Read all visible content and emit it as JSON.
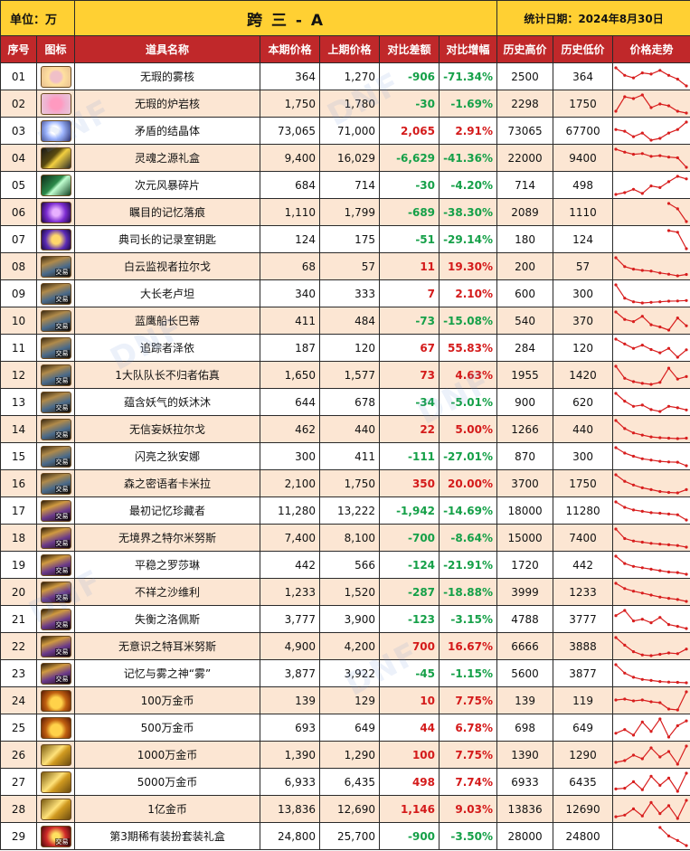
{
  "header": {
    "unit": "单位：万",
    "title": "跨 三 - A",
    "date": "统计日期：2024年8月30日"
  },
  "columns": [
    "序号",
    "图标",
    "道具名称",
    "本期价格",
    "上期价格",
    "对比差额",
    "对比增幅",
    "历史高价",
    "历史低价",
    "价格走势"
  ],
  "rows": [
    {
      "idx": "01",
      "icon": "mist-core-icon",
      "name": "无瑕的雾核",
      "cur": "364",
      "prev": "1,270",
      "diff": "-906",
      "pct": "-71.34%",
      "high": "2500",
      "low": "364",
      "trend": [
        1.8,
        1.2,
        1.0,
        1.4,
        1.3,
        1.6,
        1.2,
        0.9,
        0.36
      ]
    },
    {
      "idx": "02",
      "icon": "lava-core-icon",
      "name": "无瑕的炉岩核",
      "cur": "1,750",
      "prev": "1,780",
      "diff": "-30",
      "pct": "-1.69%",
      "high": "2298",
      "low": "1750",
      "trend": [
        1800,
        2200,
        2150,
        2250,
        1900,
        2000,
        1950,
        1800,
        1750
      ]
    },
    {
      "idx": "03",
      "icon": "crystal-icon",
      "name": "矛盾的结晶体",
      "cur": "73,065",
      "prev": "71,000",
      "diff": "2,065",
      "pct": "2.91%",
      "high": "73065",
      "low": "67700",
      "trend": [
        71000,
        70500,
        69000,
        70000,
        68000,
        68500,
        70000,
        71000,
        73065
      ]
    },
    {
      "idx": "04",
      "icon": "soul-gift-box-icon",
      "name": "灵魂之源礼盒",
      "cur": "9,400",
      "prev": "16,029",
      "diff": "-6,629",
      "pct": "-41.36%",
      "high": "22000",
      "low": "9400",
      "trend": [
        22000,
        20000,
        18500,
        19000,
        17000,
        17500,
        16500,
        16029,
        9400
      ]
    },
    {
      "idx": "05",
      "icon": "storm-shard-icon",
      "name": "次元风暴碎片",
      "cur": "684",
      "prev": "714",
      "diff": "-30",
      "pct": "-4.20%",
      "high": "714",
      "low": "498",
      "trend": [
        498,
        520,
        560,
        510,
        600,
        580,
        650,
        714,
        684
      ]
    },
    {
      "idx": "06",
      "icon": "memory-trace-icon",
      "name": "瞩目的记忆落痕",
      "cur": "1,110",
      "prev": "1,799",
      "diff": "-689",
      "pct": "-38.30%",
      "high": "2089",
      "low": "1110",
      "trend": [
        null,
        null,
        null,
        null,
        null,
        null,
        2089,
        1799,
        1110
      ]
    },
    {
      "idx": "07",
      "icon": "archive-key-icon",
      "name": "典司长的记录室钥匙",
      "cur": "124",
      "prev": "175",
      "diff": "-51",
      "pct": "-29.14%",
      "high": "180",
      "low": "124",
      "trend": [
        null,
        null,
        null,
        null,
        null,
        null,
        180,
        175,
        124
      ]
    },
    {
      "idx": "08",
      "icon": "card-icon",
      "name": "白云监视者拉尔戈",
      "cur": "68",
      "prev": "57",
      "diff": "11",
      "pct": "19.30%",
      "high": "200",
      "low": "57",
      "trend": [
        200,
        130,
        110,
        100,
        95,
        80,
        70,
        57,
        68
      ]
    },
    {
      "idx": "09",
      "icon": "card-icon",
      "name": "大长老卢坦",
      "cur": "340",
      "prev": "333",
      "diff": "7",
      "pct": "2.10%",
      "high": "600",
      "low": "300",
      "trend": [
        600,
        380,
        320,
        300,
        310,
        320,
        330,
        333,
        340
      ]
    },
    {
      "idx": "10",
      "icon": "card-icon",
      "name": "蓝鹰船长巴蒂",
      "cur": "411",
      "prev": "484",
      "diff": "-73",
      "pct": "-15.08%",
      "high": "540",
      "low": "370",
      "trend": [
        540,
        470,
        450,
        500,
        420,
        400,
        370,
        484,
        411
      ]
    },
    {
      "idx": "11",
      "icon": "card-icon",
      "name": "追踪者泽依",
      "cur": "187",
      "prev": "120",
      "diff": "67",
      "pct": "55.83%",
      "high": "284",
      "low": "120",
      "trend": [
        284,
        240,
        200,
        230,
        190,
        160,
        200,
        120,
        187
      ]
    },
    {
      "idx": "12",
      "icon": "card-icon",
      "name": "1大队队长不归者佑真",
      "cur": "1,650",
      "prev": "1,577",
      "diff": "73",
      "pct": "4.63%",
      "high": "1955",
      "low": "1420",
      "trend": [
        1955,
        1600,
        1500,
        1450,
        1420,
        1480,
        1900,
        1577,
        1650
      ]
    },
    {
      "idx": "13",
      "icon": "card-icon",
      "name": "蕴含妖气的妖沐沐",
      "cur": "644",
      "prev": "678",
      "diff": "-34",
      "pct": "-5.01%",
      "high": "900",
      "low": "620",
      "trend": [
        900,
        780,
        700,
        720,
        650,
        620,
        700,
        678,
        644
      ]
    },
    {
      "idx": "14",
      "icon": "card-icon",
      "name": "无信妄妖拉尔戈",
      "cur": "462",
      "prev": "440",
      "diff": "22",
      "pct": "5.00%",
      "high": "1266",
      "low": "440",
      "trend": [
        1266,
        900,
        700,
        600,
        520,
        480,
        460,
        440,
        462
      ]
    },
    {
      "idx": "15",
      "icon": "card-icon",
      "name": "闪亮之狄安娜",
      "cur": "300",
      "prev": "411",
      "diff": "-111",
      "pct": "-27.01%",
      "high": "870",
      "low": "300",
      "trend": [
        870,
        700,
        600,
        520,
        480,
        440,
        420,
        411,
        300
      ]
    },
    {
      "idx": "16",
      "icon": "card-icon",
      "name": "森之密语者卡米拉",
      "cur": "2,100",
      "prev": "1,750",
      "diff": "350",
      "pct": "20.00%",
      "high": "3700",
      "low": "1750",
      "trend": [
        3700,
        3000,
        2600,
        2300,
        2100,
        1900,
        1800,
        1750,
        2100
      ]
    },
    {
      "idx": "17",
      "icon": "card-gold-icon",
      "name": "最初记忆珍藏者",
      "cur": "11,280",
      "prev": "13,222",
      "diff": "-1,942",
      "pct": "-14.69%",
      "high": "18000",
      "low": "11280",
      "trend": [
        18000,
        16000,
        15000,
        14500,
        14000,
        13800,
        13500,
        13222,
        11280
      ]
    },
    {
      "idx": "18",
      "icon": "card-gold-icon",
      "name": "无境界之特尔米努斯",
      "cur": "7,400",
      "prev": "8,100",
      "diff": "-700",
      "pct": "-8.64%",
      "high": "15000",
      "low": "7400",
      "trend": [
        15000,
        11000,
        10000,
        9500,
        9000,
        8700,
        8400,
        8100,
        7400
      ]
    },
    {
      "idx": "19",
      "icon": "card-gold-icon",
      "name": "平稳之罗莎琳",
      "cur": "442",
      "prev": "566",
      "diff": "-124",
      "pct": "-21.91%",
      "high": "1720",
      "low": "442",
      "trend": [
        1720,
        1200,
        1000,
        900,
        800,
        700,
        600,
        566,
        442
      ]
    },
    {
      "idx": "20",
      "icon": "card-gold-icon",
      "name": "不祥之沙维利",
      "cur": "1,233",
      "prev": "1,520",
      "diff": "-287",
      "pct": "-18.88%",
      "high": "3999",
      "low": "1233",
      "trend": [
        3999,
        3200,
        2800,
        2500,
        2200,
        1900,
        1700,
        1520,
        1233
      ]
    },
    {
      "idx": "21",
      "icon": "card-gold-icon",
      "name": "失衡之洛佩斯",
      "cur": "3,777",
      "prev": "3,900",
      "diff": "-123",
      "pct": "-3.15%",
      "high": "4788",
      "low": "3777",
      "trend": [
        4500,
        4788,
        4200,
        4300,
        4100,
        4400,
        4000,
        3900,
        3777
      ]
    },
    {
      "idx": "22",
      "icon": "card-gold-icon",
      "name": "无意识之特耳米努斯",
      "cur": "4,900",
      "prev": "4,200",
      "diff": "700",
      "pct": "16.67%",
      "high": "6666",
      "low": "3888",
      "trend": [
        6666,
        5500,
        4500,
        4000,
        3888,
        4100,
        4300,
        4200,
        4900
      ]
    },
    {
      "idx": "23",
      "icon": "card-gold-icon",
      "name": "记忆与雾之神“雾”",
      "cur": "3,877",
      "prev": "3,922",
      "diff": "-45",
      "pct": "-1.15%",
      "high": "5600",
      "low": "3877",
      "trend": [
        5600,
        4800,
        4400,
        4200,
        4100,
        4000,
        3950,
        3922,
        3877
      ]
    },
    {
      "idx": "24",
      "icon": "coin-pouch-icon",
      "name": "100万金币",
      "cur": "139",
      "prev": "129",
      "diff": "10",
      "pct": "7.75%",
      "high": "139",
      "low": "119",
      "trend": [
        130,
        131,
        129,
        130,
        128,
        127,
        120,
        119,
        139
      ]
    },
    {
      "idx": "25",
      "icon": "coin-pouch-icon",
      "name": "500万金币",
      "cur": "693",
      "prev": "649",
      "diff": "44",
      "pct": "6.78%",
      "high": "698",
      "low": "649",
      "trend": [
        660,
        670,
        655,
        690,
        665,
        698,
        650,
        680,
        693
      ]
    },
    {
      "idx": "26",
      "icon": "gold-bar-icon",
      "name": "1000万金币",
      "cur": "1,390",
      "prev": "1,290",
      "diff": "100",
      "pct": "7.75%",
      "high": "1390",
      "low": "1290",
      "trend": [
        1300,
        1310,
        1340,
        1320,
        1380,
        1330,
        1360,
        1290,
        1390
      ]
    },
    {
      "idx": "27",
      "icon": "gold-bar-icon",
      "name": "5000万金币",
      "cur": "6,933",
      "prev": "6,435",
      "diff": "498",
      "pct": "7.74%",
      "high": "6933",
      "low": "6435",
      "trend": [
        6500,
        6520,
        6700,
        6480,
        6850,
        6600,
        6800,
        6435,
        6933
      ]
    },
    {
      "idx": "28",
      "icon": "gold-pile-icon",
      "name": "1亿金币",
      "cur": "13,836",
      "prev": "12,690",
      "diff": "1,146",
      "pct": "9.03%",
      "high": "13836",
      "low": "12690",
      "trend": [
        12800,
        12900,
        13300,
        12850,
        13700,
        13000,
        13500,
        12690,
        13836
      ]
    },
    {
      "idx": "29",
      "icon": "gift-box-icon",
      "name": "第3期稀有装扮套装礼盒",
      "cur": "24,800",
      "prev": "25,700",
      "diff": "-900",
      "pct": "-3.50%",
      "high": "28000",
      "low": "24800",
      "trend": [
        null,
        null,
        null,
        null,
        null,
        28000,
        26500,
        25700,
        24800
      ]
    }
  ],
  "icon_tag": "交易",
  "colors": {
    "title_bg": "#ffd033",
    "header_bg": "#c0282a",
    "row_alt": "#fce6d3",
    "up": "#d41a1a",
    "down": "#15a048",
    "trend_line": "#d81e1e"
  }
}
